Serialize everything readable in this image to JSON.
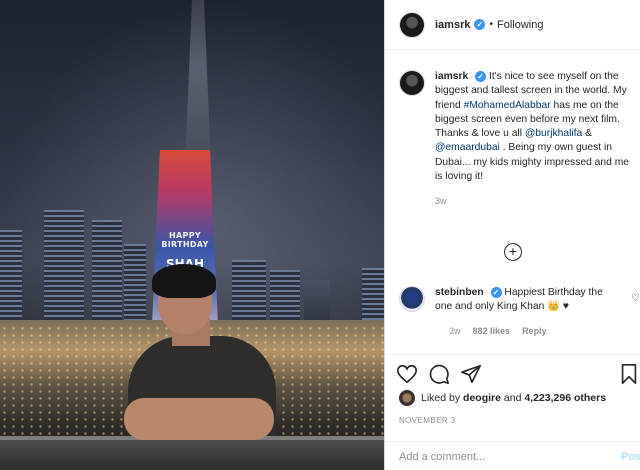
{
  "photo": {
    "alt_scene": "",
    "tower_line1": "HAPPY BIRTHDAY",
    "tower_line2": "SHAH"
  },
  "header": {
    "username": "iamsrk",
    "verified_mark": "✓",
    "separator": "•",
    "follow_status": "Following"
  },
  "caption": {
    "username": "iamsrk",
    "verified_mark": "✓",
    "part1": " It's nice to see myself on the biggest and tallest screen in the world. My friend ",
    "hashtag": "#MohamedAlabbar",
    "part2": " has me on the biggest screen even before my next film. Thanks & love u all ",
    "mention1": "@burjkhalifa",
    "amp": " & ",
    "mention2": "@emaardubai",
    "part3": " . Being my own guest in Dubai... my kids mighty impressed and me is loving it!",
    "time": "3w"
  },
  "add_icon": "+",
  "comment": {
    "username": "stebinben",
    "verified_mark": "✓",
    "text": " Happiest Birthday the one and only King Khan 👑 ♥",
    "time": "3w",
    "likes": "882 likes",
    "reply": "Reply",
    "heart": "♡"
  },
  "likes": {
    "prefix": "Liked by ",
    "user": "deogire",
    "middle": " and ",
    "count": "4,223,296 others"
  },
  "date": "NOVEMBER 3",
  "add_comment": {
    "placeholder": "Add a comment...",
    "post": "Post"
  }
}
